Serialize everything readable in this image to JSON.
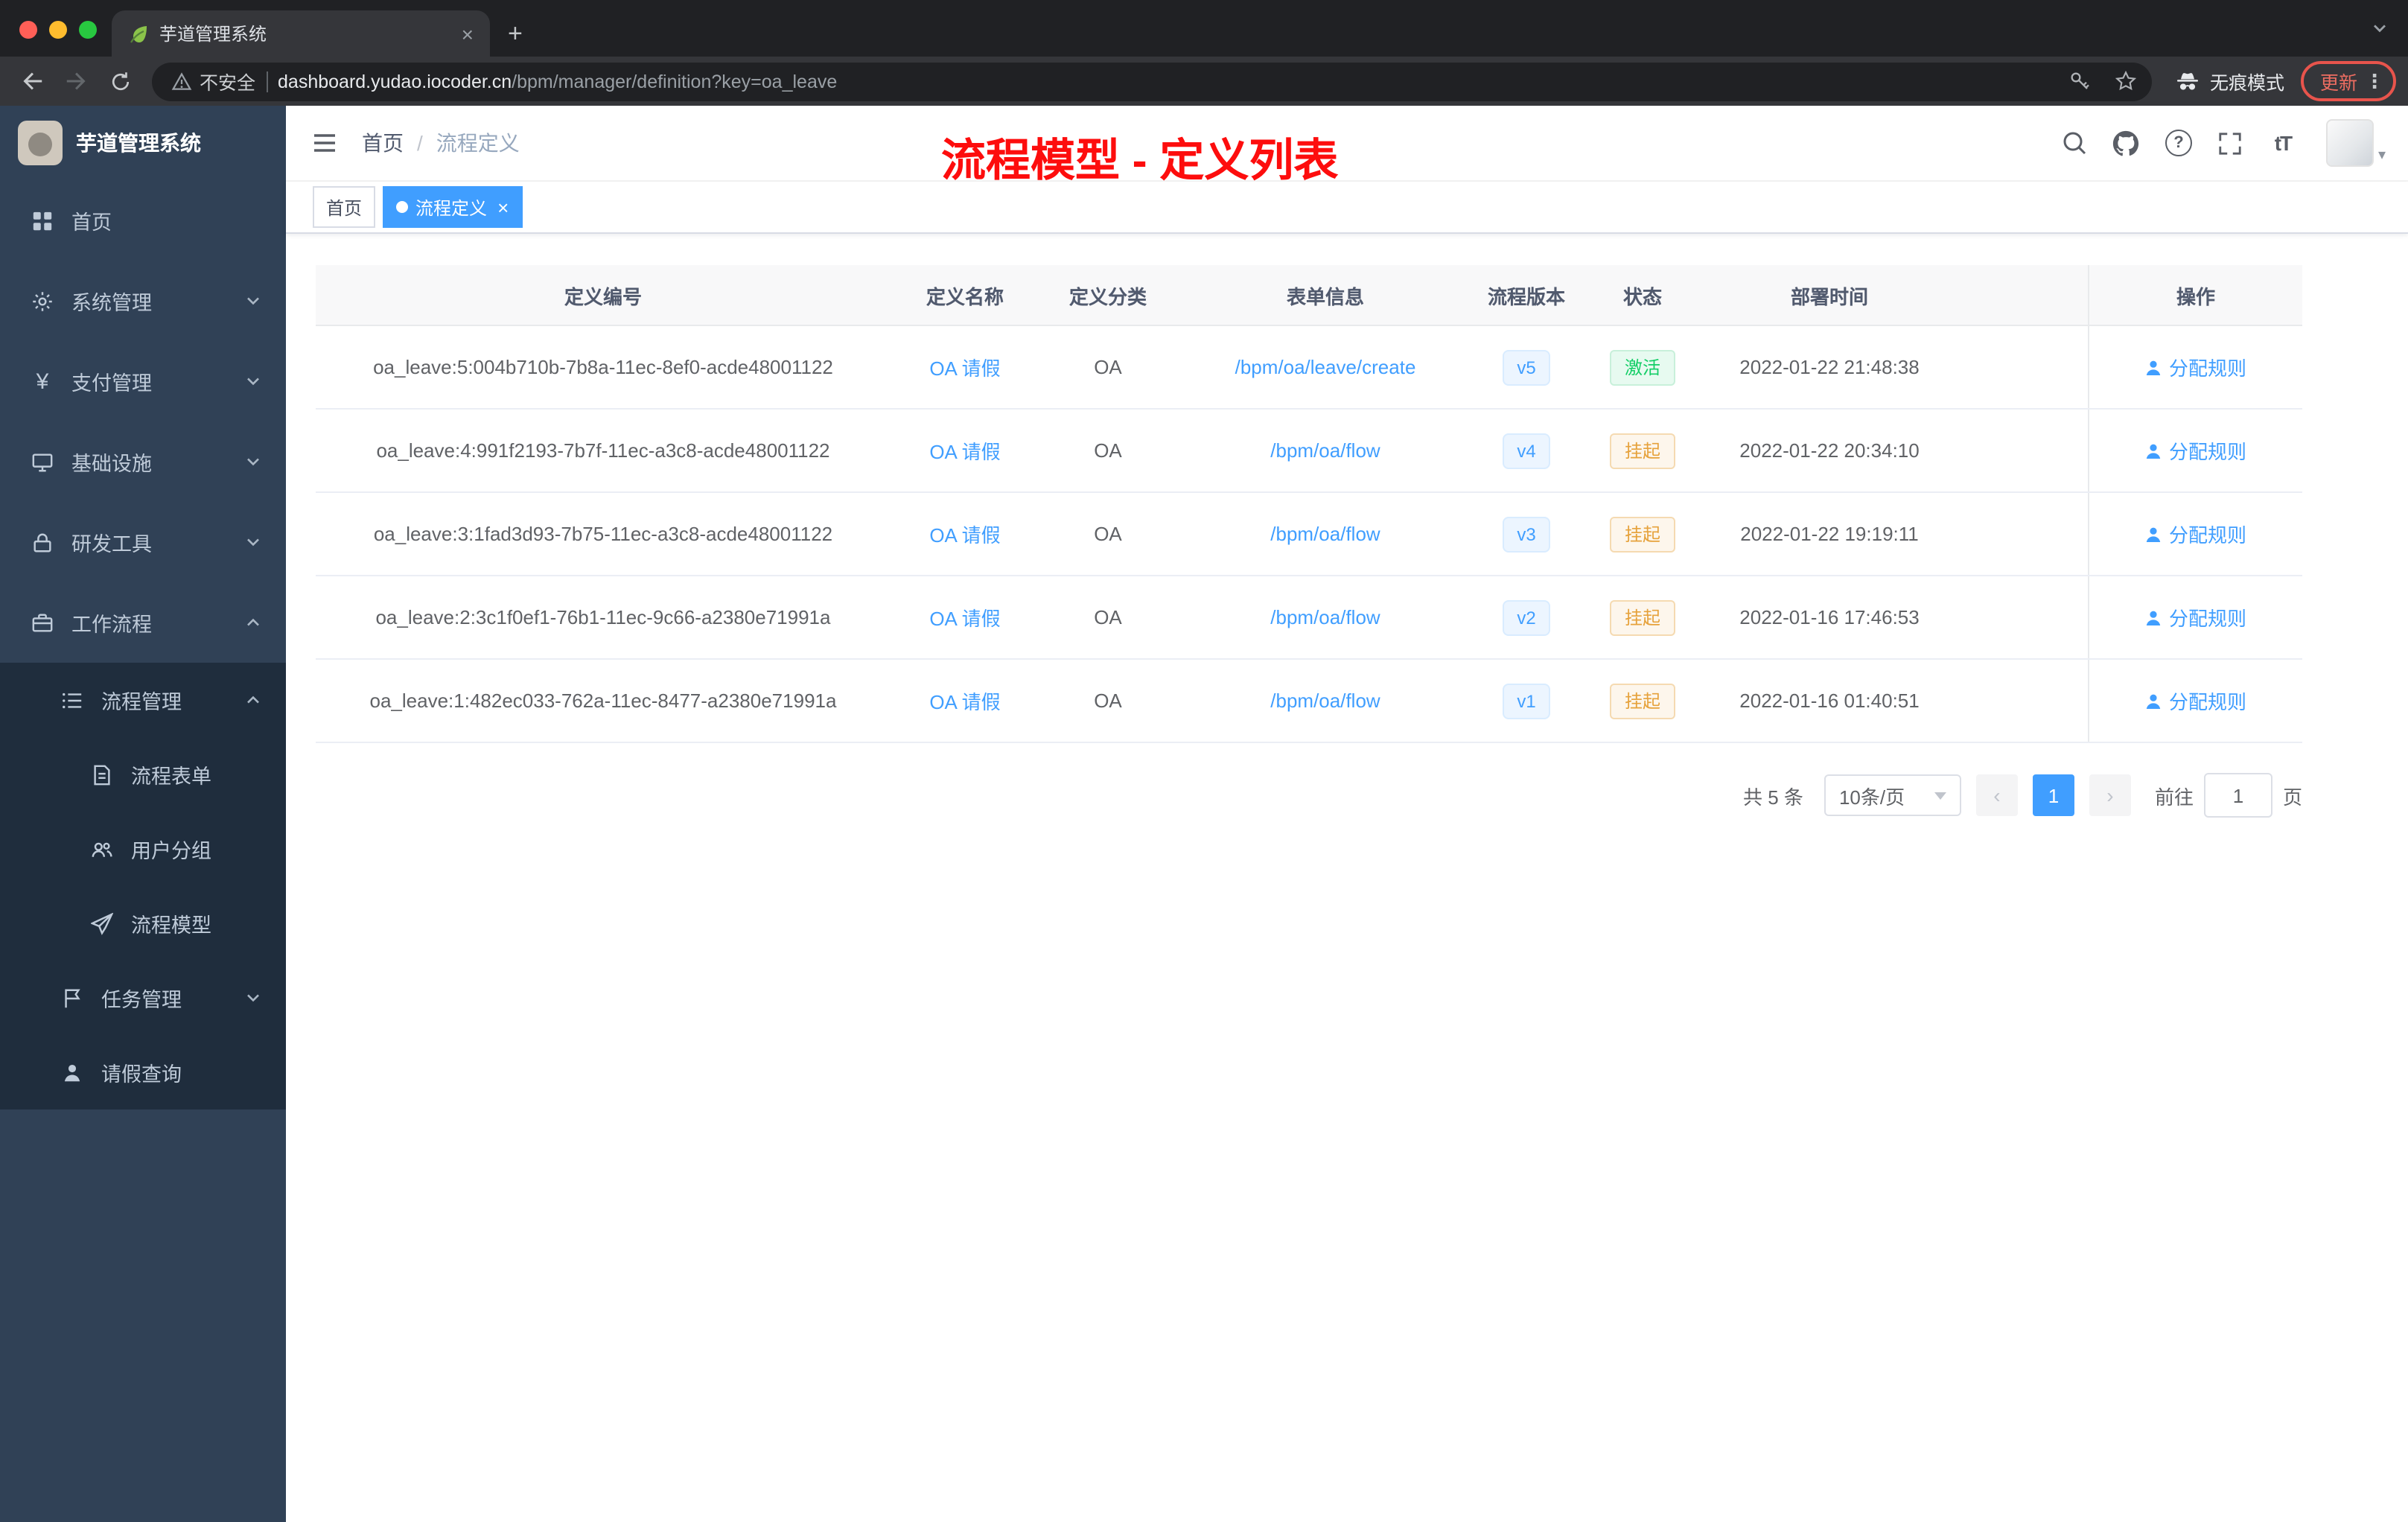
{
  "colors": {
    "accent_blue": "#409eff",
    "success_green": "#13ce66",
    "warning_orange": "#e6a23c",
    "annotation_red": "#fd0d0d",
    "sidebar_bg": "#304156",
    "submenu_bg": "#1f2d3d"
  },
  "browser": {
    "tab_title": "芋道管理系统",
    "security_label": "不安全",
    "url_host": "dashboard.yudao.iocoder.cn",
    "url_path": "/bpm/manager/definition?key=oa_leave",
    "incognito_label": "无痕模式",
    "update_label": "更新"
  },
  "icons": {
    "plus": "+",
    "close": "×",
    "dots": "⋮",
    "question": "?",
    "font_size": "tT",
    "caret_down": "▾",
    "payment_glyph": "¥",
    "prev": "‹",
    "next": "›"
  },
  "sidebar": {
    "logo_title": "芋道管理系统",
    "items": {
      "home": "首页",
      "system": "系统管理",
      "payment": "支付管理",
      "infra": "基础设施",
      "devtools": "研发工具",
      "workflow": "工作流程",
      "process_mgmt": "流程管理",
      "process_form": "流程表单",
      "user_group": "用户分组",
      "process_model": "流程模型",
      "task_mgmt": "任务管理",
      "leave_query": "请假查询"
    }
  },
  "header": {
    "breadcrumb_home": "首页",
    "breadcrumb_sep": "/",
    "breadcrumb_current": "流程定义",
    "annotation": "流程模型 - 定义列表"
  },
  "tags": {
    "home": "首页",
    "active": "流程定义"
  },
  "table": {
    "columns": [
      "定义编号",
      "定义名称",
      "定义分类",
      "表单信息",
      "流程版本",
      "状态",
      "部署时间",
      "操作"
    ],
    "rows": [
      {
        "id": "oa_leave:5:004b710b-7b8a-11ec-8ef0-acde48001122",
        "name": "OA 请假",
        "category": "OA",
        "form": "/bpm/oa/leave/create",
        "version": "v5",
        "status": "激活",
        "status_type": "success",
        "time": "2022-01-22 21:48:38",
        "action": "分配规则"
      },
      {
        "id": "oa_leave:4:991f2193-7b7f-11ec-a3c8-acde48001122",
        "name": "OA 请假",
        "category": "OA",
        "form": "/bpm/oa/flow",
        "version": "v4",
        "status": "挂起",
        "status_type": "warning",
        "time": "2022-01-22 20:34:10",
        "action": "分配规则"
      },
      {
        "id": "oa_leave:3:1fad3d93-7b75-11ec-a3c8-acde48001122",
        "name": "OA 请假",
        "category": "OA",
        "form": "/bpm/oa/flow",
        "version": "v3",
        "status": "挂起",
        "status_type": "warning",
        "time": "2022-01-22 19:19:11",
        "action": "分配规则"
      },
      {
        "id": "oa_leave:2:3c1f0ef1-76b1-11ec-9c66-a2380e71991a",
        "name": "OA 请假",
        "category": "OA",
        "form": "/bpm/oa/flow",
        "version": "v2",
        "status": "挂起",
        "status_type": "warning",
        "time": "2022-01-16 17:46:53",
        "action": "分配规则"
      },
      {
        "id": "oa_leave:1:482ec033-762a-11ec-8477-a2380e71991a",
        "name": "OA 请假",
        "category": "OA",
        "form": "/bpm/oa/flow",
        "version": "v1",
        "status": "挂起",
        "status_type": "warning",
        "time": "2022-01-16 01:40:51",
        "action": "分配规则"
      }
    ]
  },
  "pagination": {
    "total": "共 5 条",
    "page_size": "10条/页",
    "current_page": "1",
    "goto_label": "前往",
    "goto_value": "1",
    "page_unit": "页"
  }
}
